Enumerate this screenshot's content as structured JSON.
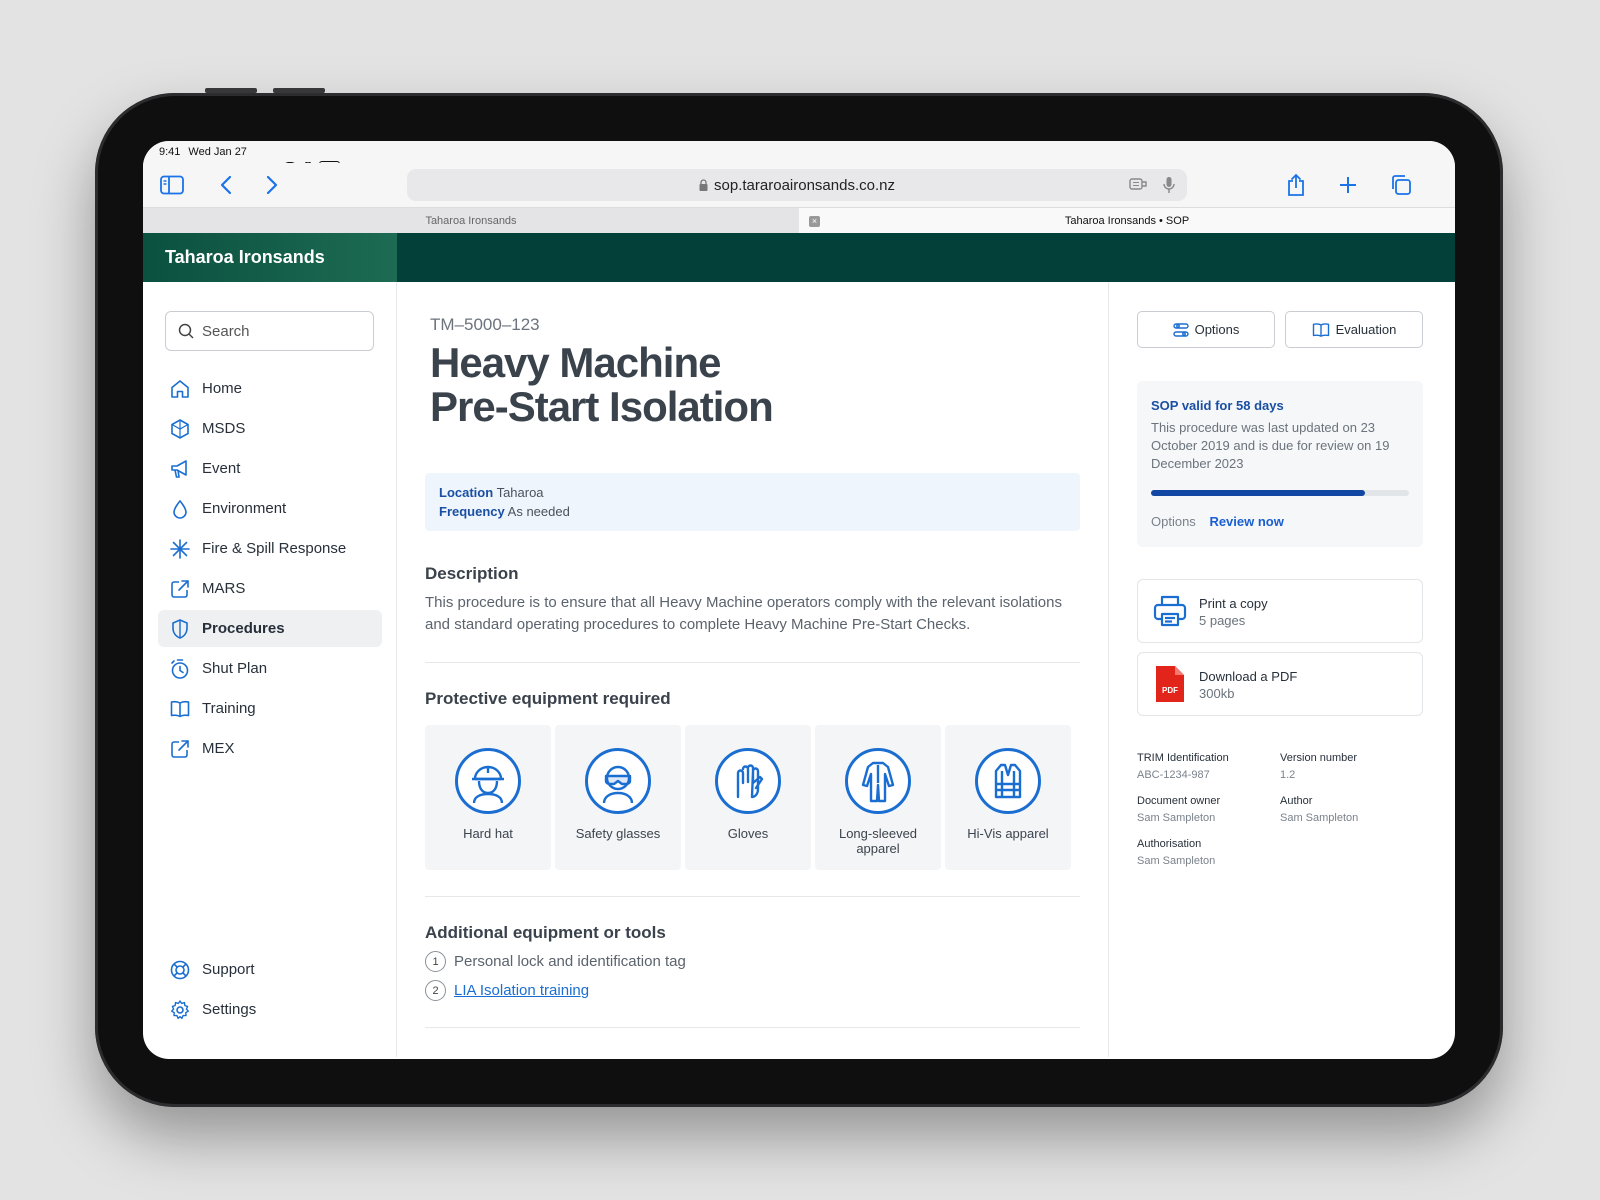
{
  "status": {
    "time": "9:41",
    "date": "Wed Jan 27"
  },
  "browser": {
    "url": "sop.tararoaironsands.co.nz",
    "tabs": [
      {
        "label": "Taharoa Ironsands"
      },
      {
        "label": "Taharoa Ironsands • SOP"
      }
    ]
  },
  "site": {
    "brand": "Taharoa Ironsands"
  },
  "sidebar": {
    "search_placeholder": "Search",
    "items": [
      {
        "label": "Home",
        "icon": "home-icon"
      },
      {
        "label": "MSDS",
        "icon": "hazard-icon"
      },
      {
        "label": "Event",
        "icon": "megaphone-icon"
      },
      {
        "label": "Environment",
        "icon": "drop-icon"
      },
      {
        "label": "Fire & Spill Response",
        "icon": "asterisk-icon"
      },
      {
        "label": "MARS",
        "icon": "external-link-icon"
      },
      {
        "label": "Procedures",
        "icon": "shield-icon",
        "active": true
      },
      {
        "label": "Shut Plan",
        "icon": "stopwatch-icon"
      },
      {
        "label": "Training",
        "icon": "book-icon"
      },
      {
        "label": "MEX",
        "icon": "external-link-icon"
      }
    ],
    "bottom": [
      {
        "label": "Support",
        "icon": "lifebuoy-icon"
      },
      {
        "label": "Settings",
        "icon": "gear-icon"
      }
    ]
  },
  "main": {
    "doc_id": "TM–5000–123",
    "title_line1": "Heavy Machine",
    "title_line2": "Pre-Start Isolation",
    "location_label": "Location",
    "location_value": "Taharoa",
    "frequency_label": "Frequency",
    "frequency_value": "As needed",
    "description_title": "Description",
    "description_text": "This procedure is to ensure that all Heavy Machine operators comply with the relevant isolations and standard operating procedures to complete Heavy Machine Pre-Start Checks.",
    "ppe_title": "Protective equipment required",
    "ppe": [
      {
        "label": "Hard hat",
        "icon": "hard-hat-icon"
      },
      {
        "label": "Safety glasses",
        "icon": "safety-glasses-icon"
      },
      {
        "label": "Gloves",
        "icon": "gloves-icon"
      },
      {
        "label": "Long-sleeved apparel",
        "icon": "coverall-icon"
      },
      {
        "label": "Hi-Vis apparel",
        "icon": "hi-vis-vest-icon"
      }
    ],
    "tools_title": "Additional equipment or tools",
    "tools": [
      {
        "num": "1",
        "label": "Personal lock and identification tag"
      },
      {
        "num": "2",
        "label": "LIA Isolation training"
      }
    ]
  },
  "right": {
    "options_label": "Options",
    "evaluation_label": "Evaluation",
    "validity_title": "SOP valid for 58 days",
    "validity_text": "This procedure was last updated on 23 October 2019 and is due for review on 19 December 2023",
    "validity_progress": 0.83,
    "validity_options": "Options",
    "validity_review": "Review now",
    "print_title": "Print a copy",
    "print_sub": "5 pages",
    "pdf_title": "Download a PDF",
    "pdf_sub": "300kb",
    "pdf_badge": "PDF",
    "info": [
      {
        "k": "TRIM Identification",
        "v": "ABC-1234-987"
      },
      {
        "k": "Version number",
        "v": "1.2"
      },
      {
        "k": "Document owner",
        "v": "Sam Sampleton"
      },
      {
        "k": "Author",
        "v": "Sam Sampleton"
      },
      {
        "k": "Authorisation",
        "v": "Sam Sampleton"
      }
    ]
  },
  "colors": {
    "brand_dark": "#04403a",
    "accent_blue": "#1b6ed1",
    "progress": "#1347a4"
  }
}
